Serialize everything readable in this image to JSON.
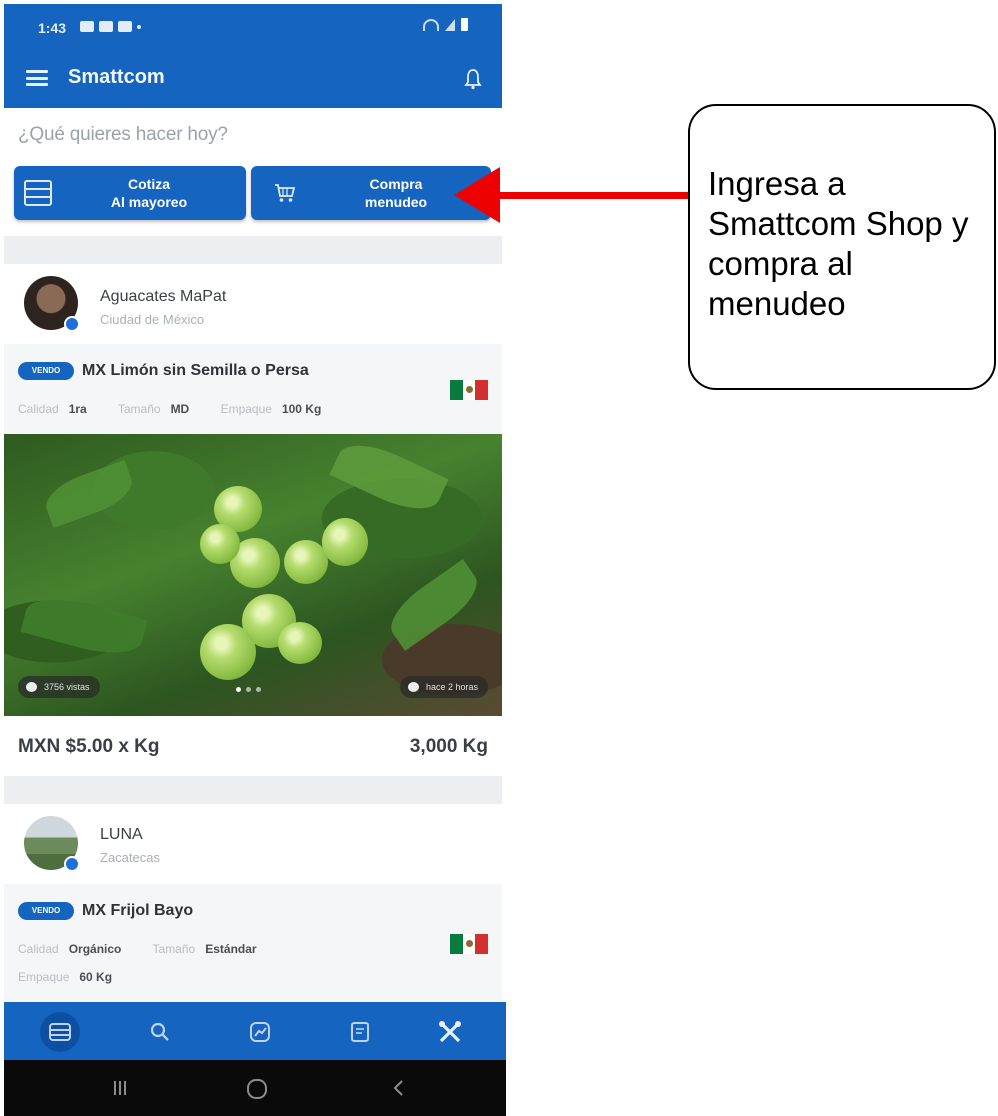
{
  "status_bar": {
    "time": "1:43"
  },
  "app_bar": {
    "title": "Smattcom"
  },
  "home": {
    "prompt": "¿Qué quieres hacer hoy?",
    "actions": [
      {
        "line1": "Cotiza",
        "line2": "Al mayoreo",
        "icon": "stack-icon"
      },
      {
        "line1": "Compra",
        "line2": "menudeo",
        "icon": "cart-icon"
      }
    ]
  },
  "posts": [
    {
      "seller": "Aguacates MaPat",
      "location": "Ciudad de México",
      "badge": "VENDO",
      "product": "MX Limón sin Semilla o Persa",
      "specs": [
        {
          "label": "Calidad",
          "value": "1ra"
        },
        {
          "label": "Tamaño",
          "value": "MD"
        },
        {
          "label": "Empaque",
          "value": "100 Kg"
        }
      ],
      "views": "3756 vistas",
      "posted": "hace 2 horas",
      "price": "MXN $5.00 x Kg",
      "quantity": "3,000 Kg"
    },
    {
      "seller": "LUNA",
      "location": "Zacatecas",
      "badge": "VENDO",
      "product": "MX Frijol Bayo",
      "specs": [
        {
          "label": "Calidad",
          "value": "Orgánico"
        },
        {
          "label": "Tamaño",
          "value": "Estándar"
        },
        {
          "label": "Empaque",
          "value": "60 Kg"
        }
      ]
    }
  ],
  "bottom_nav": [
    {
      "name": "feed-icon",
      "active": true
    },
    {
      "name": "search-icon",
      "active": false
    },
    {
      "name": "chart-icon",
      "active": false
    },
    {
      "name": "notes-icon",
      "active": false
    },
    {
      "name": "tools-icon",
      "active": false
    }
  ],
  "callout": {
    "text": "Ingresa a Smattcom Shop y compra al menudeo"
  },
  "colors": {
    "primary": "#1565c0",
    "arrow": "#ee0000"
  }
}
